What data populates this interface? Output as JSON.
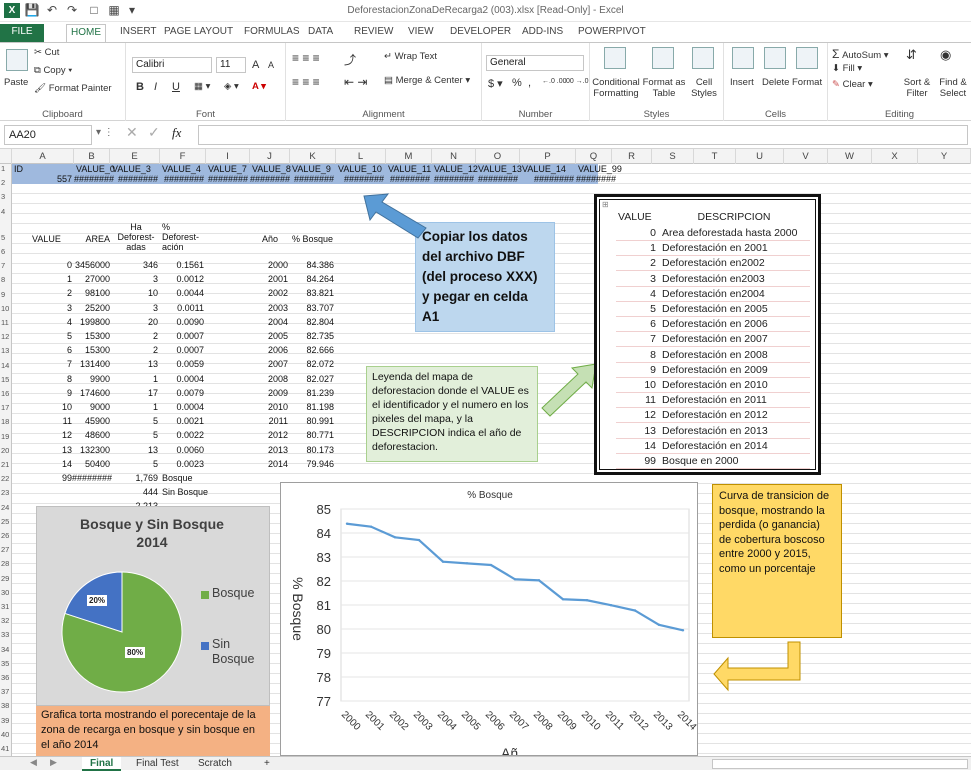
{
  "window": {
    "title": "DeforestacionZonaDeRecarga2 (003).xlsx [Read-Only] - Excel",
    "app_icon": "excel-icon"
  },
  "tabs": [
    "FILE",
    "HOME",
    "INSERT",
    "PAGE LAYOUT",
    "FORMULAS",
    "DATA",
    "REVIEW",
    "VIEW",
    "DEVELOPER",
    "ADD-INS",
    "POWERPIVOT"
  ],
  "ribbon": {
    "clipboard": {
      "paste": "Paste",
      "cut": "Cut",
      "copy": "Copy",
      "format_painter": "Format Painter",
      "label": "Clipboard"
    },
    "font": {
      "name": "Calibri",
      "size": "11",
      "grow": "A",
      "shrink": "A",
      "bold": "B",
      "italic": "I",
      "underline": "U",
      "label": "Font"
    },
    "alignment": {
      "wrap": "Wrap Text",
      "merge": "Merge & Center",
      "label": "Alignment"
    },
    "number": {
      "format": "General",
      "currency": "$",
      "percent": "%",
      "comma": ",",
      "inc": "←.0 .00",
      "dec": ".00 →.0",
      "label": "Number"
    },
    "styles": {
      "conditional": "Conditional Formatting",
      "format_table": "Format as Table",
      "cell_styles": "Cell Styles",
      "label": "Styles"
    },
    "cells": {
      "insert": "Insert",
      "delete": "Delete",
      "format": "Format",
      "label": "Cells"
    },
    "editing": {
      "autosum": "AutoSum",
      "fill": "Fill",
      "clear": "Clear",
      "sort": "Sort & Filter",
      "find": "Find & Select",
      "label": "Editing"
    }
  },
  "formula_bar": {
    "name_box": "AA20",
    "fx": "fx",
    "content": ""
  },
  "columns": [
    "A",
    "B",
    "E",
    "F",
    "I",
    "J",
    "K",
    "L",
    "M",
    "N",
    "O",
    "P",
    "Q",
    "R",
    "S",
    "T",
    "U",
    "V",
    "W",
    "X",
    "Y"
  ],
  "rows": [
    "1",
    "2",
    "3",
    "4",
    "5",
    "6",
    "7",
    "8",
    "9",
    "10",
    "11",
    "12",
    "13",
    "14",
    "15",
    "16",
    "17",
    "18",
    "19",
    "20",
    "21",
    "22",
    "23",
    "24",
    "25",
    "26",
    "27",
    "28",
    "29",
    "30",
    "31",
    "32",
    "33",
    "34",
    "35",
    "36",
    "37",
    "38",
    "39",
    "40",
    "41"
  ],
  "row1": [
    "ID",
    "VALUE_0",
    "VALUE_3",
    "VALUE_4",
    "VALUE_7",
    "VALUE_8",
    "VALUE_9",
    "VALUE_10",
    "VALUE_11",
    "VALUE_12",
    "VALUE_13",
    "VALUE_14",
    "VALUE_99"
  ],
  "row2": [
    "557",
    "########",
    "########",
    "########",
    "########",
    "########",
    "########",
    "########",
    "########",
    "########",
    "########",
    "########",
    "########"
  ],
  "table_header": {
    "value": "VALUE",
    "area": "AREA",
    "ha": "Ha Deforest-adas",
    "pct": "% Deforest-ación",
    "anio": "Año",
    "bosque": "% Bosque"
  },
  "table_rows": [
    [
      "0",
      "3456000",
      "346",
      "0.1561",
      "2000",
      "84.386"
    ],
    [
      "1",
      "27000",
      "3",
      "0.0012",
      "2001",
      "84.264"
    ],
    [
      "2",
      "98100",
      "10",
      "0.0044",
      "2002",
      "83.821"
    ],
    [
      "3",
      "25200",
      "3",
      "0.0011",
      "2003",
      "83.707"
    ],
    [
      "4",
      "199800",
      "20",
      "0.0090",
      "2004",
      "82.804"
    ],
    [
      "5",
      "15300",
      "2",
      "0.0007",
      "2005",
      "82.735"
    ],
    [
      "6",
      "15300",
      "2",
      "0.0007",
      "2006",
      "82.666"
    ],
    [
      "7",
      "131400",
      "13",
      "0.0059",
      "2007",
      "82.072"
    ],
    [
      "8",
      "9900",
      "1",
      "0.0004",
      "2008",
      "82.027"
    ],
    [
      "9",
      "174600",
      "17",
      "0.0079",
      "2009",
      "81.239"
    ],
    [
      "10",
      "9000",
      "1",
      "0.0004",
      "2010",
      "81.198"
    ],
    [
      "11",
      "45900",
      "5",
      "0.0021",
      "2011",
      "80.991"
    ],
    [
      "12",
      "48600",
      "5",
      "0.0022",
      "2012",
      "80.771"
    ],
    [
      "13",
      "132300",
      "13",
      "0.0060",
      "2013",
      "80.173"
    ],
    [
      "14",
      "50400",
      "5",
      "0.0023",
      "2014",
      "79.946"
    ]
  ],
  "row21": {
    "value": "99",
    "area": "########",
    "ha": "1,769",
    "label": "Bosque"
  },
  "row22": {
    "ha": "444",
    "label": "Sin Bosque"
  },
  "row23": {
    "ha": "2,213"
  },
  "legend_table": {
    "header_value": "VALUE",
    "header_desc": "DESCRIPCION",
    "rows": [
      [
        "0",
        "Area deforestada hasta 2000"
      ],
      [
        "1",
        "Deforestación en 2001"
      ],
      [
        "2",
        "Deforestación en2002"
      ],
      [
        "3",
        "Deforestación en2003"
      ],
      [
        "4",
        "Deforestación en2004"
      ],
      [
        "5",
        "Deforestación en 2005"
      ],
      [
        "6",
        "Deforestación en 2006"
      ],
      [
        "7",
        "Deforestación en 2007"
      ],
      [
        "8",
        "Deforestación en 2008"
      ],
      [
        "9",
        "Deforestación en 2009"
      ],
      [
        "10",
        "Deforestación en 2010"
      ],
      [
        "11",
        "Deforestación en 2011"
      ],
      [
        "12",
        "Deforestación en 2012"
      ],
      [
        "13",
        "Deforestación en 2013"
      ],
      [
        "14",
        "Deforestación en 2014"
      ],
      [
        "99",
        "Bosque en 2000"
      ]
    ]
  },
  "notes": {
    "copy": "Copiar los datos del archivo DBF (del proceso XXX) y pegar en celda A1",
    "legend": "Leyenda del mapa de deforestacion donde el VALUE es el identificador y el numero en los pixeles del mapa, y la DESCRIPCION indica el año de deforestacion.",
    "curve": "Curva de transicion de bosque, mostrando la perdida (o ganancia) de cobertura boscoso entre 2000 y 2015, como un porcentaje",
    "pie": "Grafica torta mostrando el porecentaje de la zona de recarga en bosque y sin bosque en el año 2014"
  },
  "pie_chart": {
    "title": "Bosque y Sin Bosque 2014",
    "legend": [
      "Bosque",
      "Sin Bosque"
    ],
    "labels": [
      "80%",
      "20%"
    ],
    "colors": [
      "#70ad47",
      "#4472c4"
    ],
    "values": [
      80,
      20
    ]
  },
  "chart_data": {
    "type": "line",
    "title": "% Bosque",
    "ylabel": "% Bosque",
    "xlabel": "Añ",
    "ylim": [
      77,
      85
    ],
    "x": [
      "2000",
      "2001",
      "2002",
      "2003",
      "2004",
      "2005",
      "2006",
      "2007",
      "2008",
      "2009",
      "2010",
      "2011",
      "2012",
      "2013",
      "2014"
    ],
    "values": [
      84.386,
      84.264,
      83.821,
      83.707,
      82.804,
      82.735,
      82.666,
      82.072,
      82.027,
      81.239,
      81.198,
      80.991,
      80.771,
      80.173,
      79.946
    ],
    "yticks": [
      "77",
      "78",
      "79",
      "80",
      "81",
      "82",
      "83",
      "84",
      "85"
    ],
    "color": "#5b9bd5"
  },
  "sheet_tabs": [
    "Final",
    "Final Test",
    "Scratch",
    "+"
  ]
}
